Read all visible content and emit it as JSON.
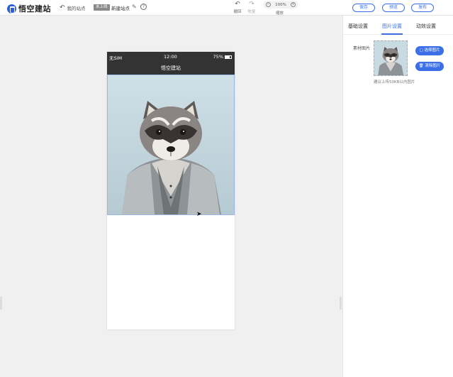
{
  "header": {
    "logo_text": "悟空建站",
    "back_label": "我的站点",
    "badge": "未上线",
    "site_name": "新建站点",
    "help_symbol": "?",
    "undo_label": "撤回",
    "redo_label": "恢复",
    "zoom_value": "100%",
    "zoom_label": "缩放",
    "save_label": "保存",
    "preview_label": "预览",
    "publish_label": "发布"
  },
  "phone": {
    "carrier": "无SIM",
    "time": "12:00",
    "battery": "75%",
    "nav_title": "悟空建站"
  },
  "panel": {
    "tabs": [
      {
        "label": "基础设置"
      },
      {
        "label": "图片设置"
      },
      {
        "label": "动效设置"
      }
    ],
    "active_tab": "图片设置",
    "field_label": "素材图片",
    "choose_label": "选择图片",
    "clear_label": "清除图片",
    "hint": "建议上传50KB以内图片"
  },
  "colors": {
    "accent": "#3a6fe8",
    "phone_bar": "#333333",
    "canvas_bg": "#f0f0f0"
  },
  "icons": [
    "logo-icon",
    "back-arrow-icon",
    "pencil-icon",
    "help-icon",
    "undo-icon",
    "redo-icon",
    "zoom-out-icon",
    "zoom-in-icon",
    "battery-icon",
    "cursor-icon",
    "image-icon",
    "trash-icon"
  ]
}
